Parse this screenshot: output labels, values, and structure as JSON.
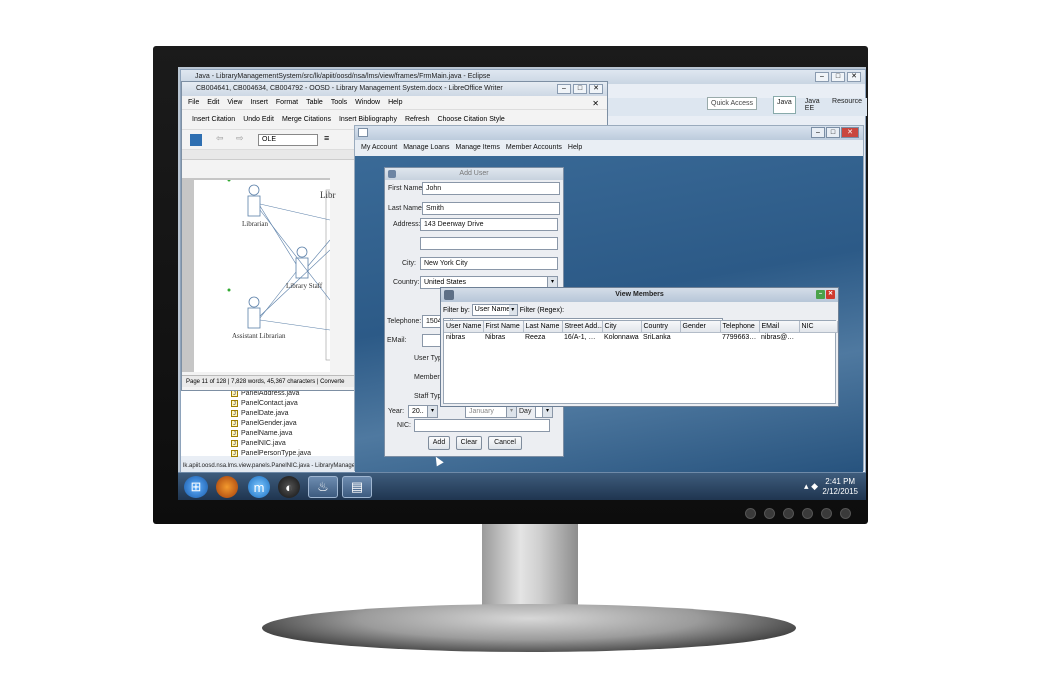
{
  "eclipse": {
    "title": "Java - LibraryManagementSystem/src/lk/apiit/oosd/nsa/lms/view/frames/FrmMain.java - Eclipse",
    "quick_access": "Quick Access",
    "perspectives": [
      "Java",
      "Java EE",
      "Resource"
    ],
    "tree_items": [
      "PanelAddress.java",
      "PanelContact.java",
      "PanelDate.java",
      "PanelGender.java",
      "PanelName.java",
      "PanelNIC.java",
      "PanelPersonType.java"
    ],
    "status": "lk.apiit.oosd.nsa.lms.view.panels.PanelNIC.java - LibraryManage"
  },
  "writer": {
    "title": "CB004641, CB004634, CB004792 - OOSD - Library Management System.docx - LibreOffice Writer",
    "menu": [
      "File",
      "Edit",
      "View",
      "Insert",
      "Format",
      "Table",
      "Tools",
      "Window",
      "Help"
    ],
    "toolbar1": [
      "Insert Citation",
      "Undo Edit",
      "Merge Citations",
      "Insert Bibliography",
      "Refresh",
      "Choose Citation Style"
    ],
    "style_value": "OLE",
    "status": "Page 11 of 128 | 7,828 words, 45,367 characters | Converte",
    "uml": {
      "librarian": "Librarian",
      "library_staff": "Library Staff",
      "assistant": "Assistant Librarian",
      "system_fragment": "Libr"
    }
  },
  "lms": {
    "menu": [
      "My Account",
      "Manage Loans",
      "Manage Items",
      "Member Accounts",
      "Help"
    ]
  },
  "adduser": {
    "title": "Add User",
    "first_name_label": "First Name:",
    "first_name_value": "John",
    "last_name_label": "Last Name:",
    "last_name_value": "Smith",
    "address_label": "Address:",
    "address_value": "143 Deerway Drive",
    "address2_value": "",
    "city_label": "City:",
    "city_value": "New York City",
    "country_label": "Country:",
    "country_value": "United States",
    "telephone_label": "Telephone:",
    "telephone_value": "1504",
    "email_label": "EMail:",
    "user_type_label": "User Typ",
    "member_label": "Members",
    "staff_type_label": "Staff Type",
    "year_label": "Year:",
    "year_value": "20..",
    "month_value": "January",
    "day_label": "Day",
    "nic_label": "NIC:",
    "add_button": "Add",
    "clear_button": "Clear",
    "cancel_button": "Cancel"
  },
  "members": {
    "title": "View Members",
    "filter_by_label": "Filter by:",
    "filter_by_value": "User Name",
    "filter_regex_label": "Filter (Regex):",
    "filter_regex_value": "nibras",
    "columns": [
      "User Name",
      "First Name",
      "Last Name",
      "Street Add...",
      "City",
      "Country",
      "Gender",
      "Telephone",
      "EMail",
      "NIC"
    ],
    "rows": [
      [
        "nibras",
        "Nibras",
        "Reeza",
        "16/A-1, Vij...",
        "Kolonnawa",
        "SriLanka",
        "",
        "779966375",
        "nibras@ni...",
        ""
      ]
    ]
  },
  "taskbar": {
    "time": "2:41 PM",
    "date": "2/12/2015"
  }
}
